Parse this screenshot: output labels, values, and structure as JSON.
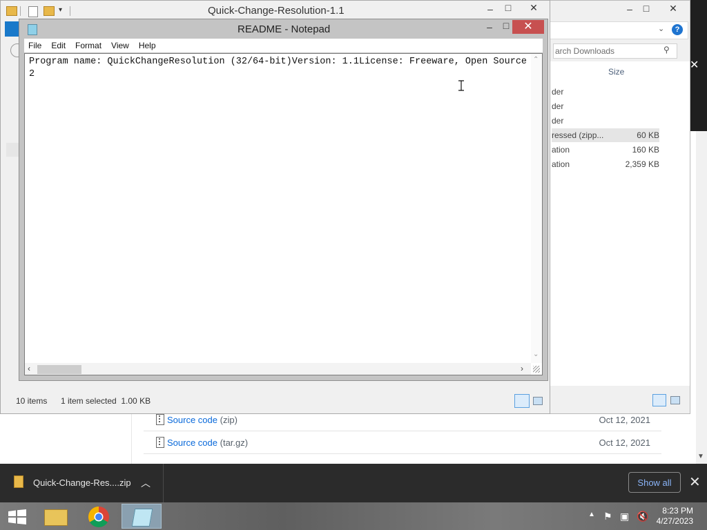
{
  "browser": {
    "assets": [
      {
        "name": "Source code",
        "ext": "(zip)",
        "date": "Oct 12, 2021"
      },
      {
        "name": "Source code",
        "ext": "(tar.gz)",
        "date": "Oct 12, 2021"
      }
    ]
  },
  "explorer": {
    "title": "Quick-Change-Resolution-1.1",
    "search_placeholder": "arch Downloads",
    "size_header": "Size",
    "rows": [
      {
        "type": "der",
        "size": ""
      },
      {
        "type": "der",
        "size": ""
      },
      {
        "type": "der",
        "size": ""
      },
      {
        "type": "ressed (zipp...",
        "size": "60 KB",
        "selected": true
      },
      {
        "type": "ation",
        "size": "160 KB"
      },
      {
        "type": "ation",
        "size": "2,359 KB"
      }
    ],
    "status_items": "10 items",
    "status_selected": "1 item selected  1.00 KB"
  },
  "notepad": {
    "title": "README - Notepad",
    "menu": [
      "File",
      "Edit",
      "Format",
      "View",
      "Help"
    ],
    "line1": "Program name: QuickChangeResolution (32/64-bit)Version: 1.1License: Freeware, Open SourceRe",
    "line2": "2"
  },
  "download_bar": {
    "filename": "Quick-Change-Res....zip",
    "show_all": "Show all"
  },
  "taskbar": {
    "time": "8:23 PM",
    "date": "4/27/2023"
  }
}
